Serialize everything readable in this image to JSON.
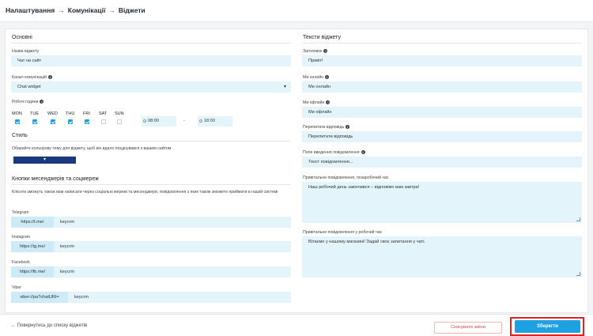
{
  "breadcrumb": {
    "item1": "Налаштування",
    "item2": "Комунікації",
    "item3": "Віджети",
    "separator": "→"
  },
  "basics": {
    "title": "Основні",
    "name_label": "Назва віджету",
    "name_value": "Чат на сайт",
    "channel_label": "Канал комунікацій",
    "channel_value": "Chat widget",
    "hours_label": "Робочі години",
    "days": [
      {
        "label": "MON",
        "checked": true
      },
      {
        "label": "TUE",
        "checked": true
      },
      {
        "label": "WED",
        "checked": true
      },
      {
        "label": "THU",
        "checked": true
      },
      {
        "label": "FRI",
        "checked": true
      },
      {
        "label": "SAT",
        "checked": false
      },
      {
        "label": "SUN",
        "checked": false
      }
    ],
    "time_from": "08:00",
    "time_dash": "-",
    "time_to": "18:00"
  },
  "style": {
    "title": "Стиль",
    "desc": "Обирайте кольорову тему для віджету, щоб він вдало поєднувався з вашим сайтом",
    "color": "#1b3a7d"
  },
  "messengers": {
    "title": "Кнопки месенджерів та соцмереж",
    "desc": "Клієнти зможуть також вам написати через соціальні мережі та месенджери, повідомлення з яких також зможете приймати в нашій системі",
    "items": [
      {
        "label": "Telegram",
        "prefix": "https://t.me/",
        "value": "keycrm"
      },
      {
        "label": "Instagram",
        "prefix": "https://ig.me/",
        "value": "keycrm"
      },
      {
        "label": "Facebook",
        "prefix": "https://fb.me/",
        "value": "keycrm"
      },
      {
        "label": "Viber",
        "prefix": "viber://pa?chatURI=",
        "value": "keycrm"
      }
    ]
  },
  "texts": {
    "title": "Тексти віджету",
    "header_label": "Заголовок",
    "header_value": "Привіт!",
    "online_label": "Ми онлайн",
    "online_value": "Ми онлайн",
    "offline_label": "Ми офлайн",
    "offline_value": "Ми офлайн",
    "interrupt_label": "Перепитати відповідь",
    "interrupt_value": "Перепитати відповідь",
    "input_label": "Поле введення повідомлення",
    "input_placeholder": "Текст повідомлення...",
    "off_hours_label": "Привітальне повідомлення, позаробочий час",
    "off_hours_value": "Наш робочий день закінчився – відповімо вам завтра!",
    "work_hours_label": "Привітальне повідомлення у робочий час",
    "work_hours_value": "Вітаємо у нашому магазині! Задай своє запитання у чаті."
  },
  "footer": {
    "back_arrow": "←",
    "back_label": "Повернутись до списку віджетів",
    "cancel_label": "Скасувати зміни",
    "save_label": "Зберегти"
  },
  "colors": {
    "accent": "#1ea1e1",
    "field_bg": "#e3f4fb",
    "highlight": "#e3211d"
  },
  "icons": {
    "chevron": "▾",
    "info": "i"
  }
}
